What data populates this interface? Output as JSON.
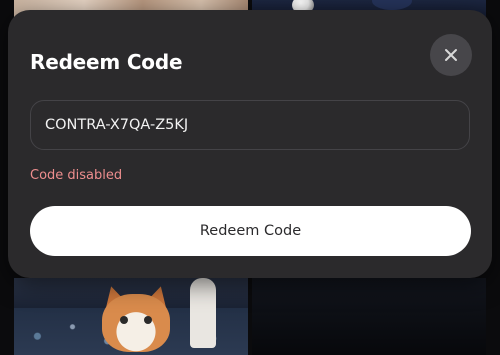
{
  "modal": {
    "title": "Redeem Code",
    "close_icon": "close-icon",
    "code_input": {
      "value": "CONTRA-X7QA-Z5KJ",
      "placeholder": ""
    },
    "error_text": "Code disabled",
    "submit_label": "Redeem Code"
  },
  "colors": {
    "modal_bg": "#2b2a2c",
    "error": "#ee8e8e",
    "primary_button_bg": "#ffffff",
    "close_button_bg": "#47464a"
  }
}
